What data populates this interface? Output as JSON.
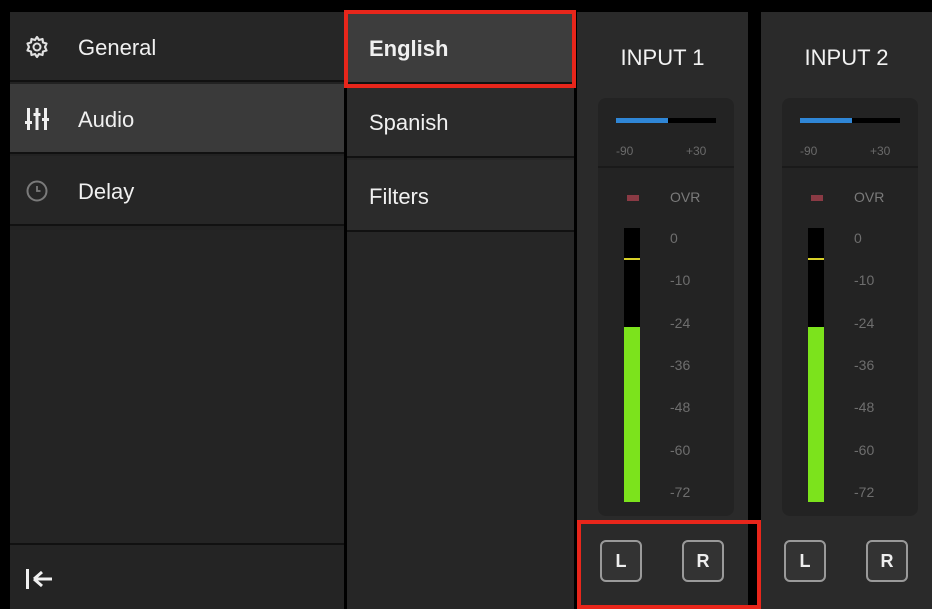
{
  "sidebar": {
    "items": [
      {
        "label": "General",
        "icon": "gear-icon",
        "active": false
      },
      {
        "label": "Audio",
        "icon": "mixer-sliders-icon",
        "active": true
      },
      {
        "label": "Delay",
        "icon": "clock-icon",
        "active": false
      }
    ],
    "footer_icon": "collapse-left-icon"
  },
  "languages": {
    "items": [
      {
        "label": "English",
        "active": true
      },
      {
        "label": "Spanish",
        "active": false
      },
      {
        "label": "Filters",
        "active": false
      }
    ]
  },
  "inputs": [
    {
      "title": "INPUT 1",
      "trim": {
        "min_label": "-90",
        "max_label": "+30",
        "level_fraction": 0.52
      },
      "ovr_label": "OVR",
      "scale": [
        "0",
        "-10",
        "-24",
        "-36",
        "-48",
        "-60",
        "-72"
      ],
      "meter_level_fraction": 0.64,
      "peak_fraction": 0.89,
      "buttons": {
        "left": "L",
        "right": "R"
      }
    },
    {
      "title": "INPUT 2",
      "trim": {
        "min_label": "-90",
        "max_label": "+30",
        "level_fraction": 0.52
      },
      "ovr_label": "OVR",
      "scale": [
        "0",
        "-10",
        "-24",
        "-36",
        "-48",
        "-60",
        "-72"
      ],
      "meter_level_fraction": 0.64,
      "peak_fraction": 0.89,
      "buttons": {
        "left": "L",
        "right": "R"
      }
    }
  ],
  "colors": {
    "highlight": "#e8261b",
    "trim_fill": "#2f86d6",
    "meter_fill": "#7ce31c",
    "peak": "#d8d028"
  }
}
